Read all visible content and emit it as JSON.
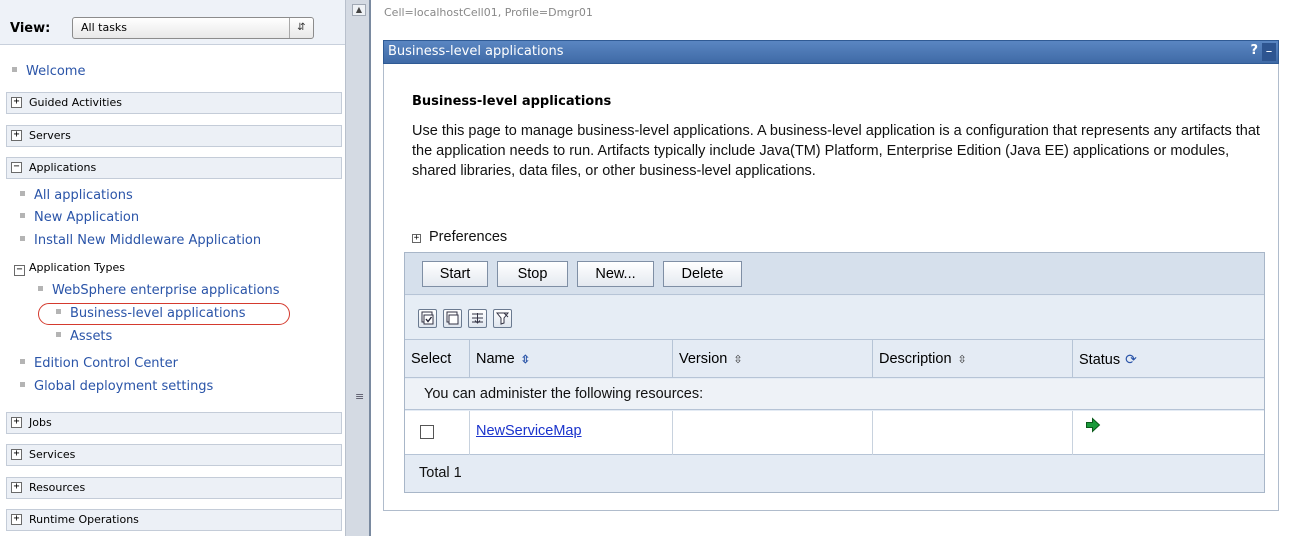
{
  "nav": {
    "view_label": "View:",
    "view_select_value": "All tasks",
    "welcome": "Welcome",
    "categories": {
      "guided": "Guided Activities",
      "servers": "Servers",
      "applications": "Applications",
      "jobs": "Jobs",
      "services": "Services",
      "resources": "Resources",
      "runtime": "Runtime Operations"
    },
    "applications_items": {
      "all": "All applications",
      "new": "New Application",
      "install": "Install New Middleware Application",
      "types_group": "Application Types",
      "websphere": "WebSphere enterprise applications",
      "bla": "Business-level applications",
      "assets": "Assets",
      "edition": "Edition Control Center",
      "global": "Global deployment settings"
    }
  },
  "breadcrumb": "Cell=localhostCell01, Profile=Dmgr01",
  "portlet": {
    "title": "Business-level applications",
    "help": "?",
    "minimize": "–"
  },
  "main": {
    "heading": "Business-level applications",
    "description": "Use this page to manage business-level applications. A business-level application is a configuration that represents any artifacts that the application needs to run. Artifacts typically include Java(TM) Platform, Enterprise Edition (Java EE) applications or modules, shared libraries, data files, or other business-level applications.",
    "preferences": "Preferences"
  },
  "toolbar": {
    "start": "Start",
    "stop": "Stop",
    "new": "New...",
    "delete": "Delete"
  },
  "table": {
    "columns": {
      "select": "Select",
      "name": "Name",
      "version": "Version",
      "description": "Description",
      "status": "Status"
    },
    "resources_message": "You can administer the following resources:",
    "rows": [
      {
        "name": "NewServiceMap",
        "version": "",
        "description": "",
        "status": "started"
      }
    ],
    "total": "Total 1"
  },
  "colors": {
    "header_blue": "#4a76b4",
    "link_blue": "#1a33cc",
    "nav_link": "#2a54a8",
    "highlight_red": "#d43a2e",
    "status_green": "#1a9a3a"
  }
}
